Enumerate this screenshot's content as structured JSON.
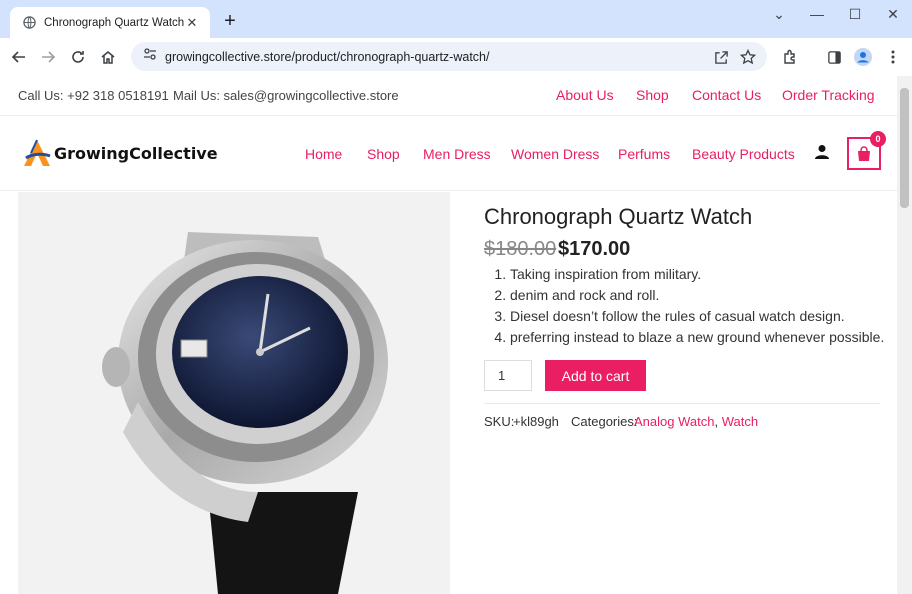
{
  "browser": {
    "tab_title": "Chronograph Quartz Watch –",
    "url": "growingcollective.store/product/chronograph-quartz-watch/",
    "new_tab_symbol": "+",
    "tab_close_symbol": "✕",
    "window_controls": {
      "dropdown": "⌄",
      "minimize": "—",
      "maximize": "☐",
      "close": "✕"
    }
  },
  "topbar": {
    "call": "Call Us: +92 318 0518191",
    "mail": "Mail Us: sales@growingcollective.store",
    "links": [
      "About Us",
      "Shop",
      "Contact Us",
      "Order Tracking"
    ]
  },
  "header": {
    "brand": "GrowingCollective",
    "menu": [
      "Home",
      "Shop",
      "Men Dress",
      "Women Dress",
      "Perfums",
      "Beauty Products"
    ],
    "cart_count": "0"
  },
  "product": {
    "title": "Chronograph Quartz Watch",
    "price_old": "$180.00",
    "price_new": "$170.00",
    "features": [
      "Taking inspiration from military.",
      "denim and rock and roll.",
      "Diesel doesn’t follow the rules of casual watch design.",
      "preferring instead to blaze a new ground whenever possible."
    ],
    "quantity": "1",
    "add_to_cart": "Add to cart",
    "sku_label": "SKU:",
    "sku_value": "+kl89gh",
    "categories_label": "Categories:",
    "categories": [
      "Analog Watch",
      "Watch"
    ],
    "category_separator": ", "
  },
  "colors": {
    "accent": "#e91e63",
    "tabstrip": "#d3e3fd"
  }
}
